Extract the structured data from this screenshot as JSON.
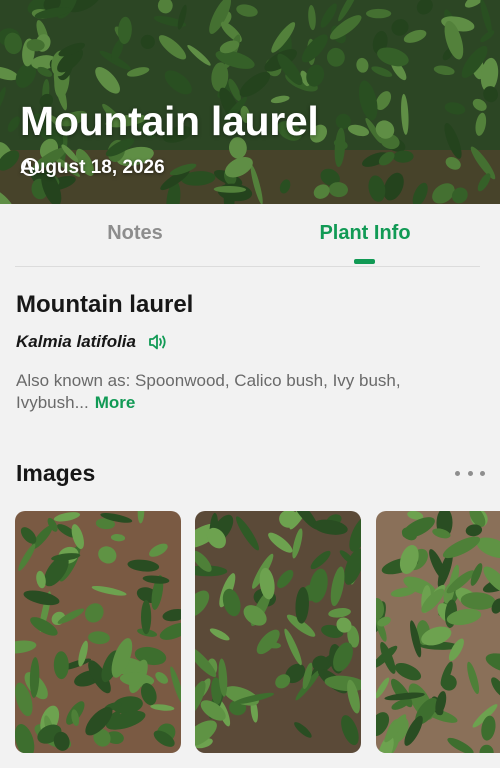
{
  "hero": {
    "title": "Mountain laurel",
    "date": "August 18, 2026",
    "date_icon": "clock-icon"
  },
  "tabs": [
    {
      "label": "Notes",
      "active": false
    },
    {
      "label": "Plant Info",
      "active": true
    }
  ],
  "plant": {
    "common_name": "Mountain laurel",
    "scientific_name": "Kalmia latifolia",
    "pronounce_icon": "speaker-icon",
    "aka_text": "Also known as: Spoonwood, Calico bush, Ivy bush, Ivybush...",
    "more_label": "More"
  },
  "images": {
    "title": "Images",
    "menu_icon": "ellipsis-icon",
    "thumbnails": 3
  },
  "colors": {
    "accent": "#119a55",
    "background": "#f2f2f2",
    "inactive_tab": "#8d8d8d"
  }
}
